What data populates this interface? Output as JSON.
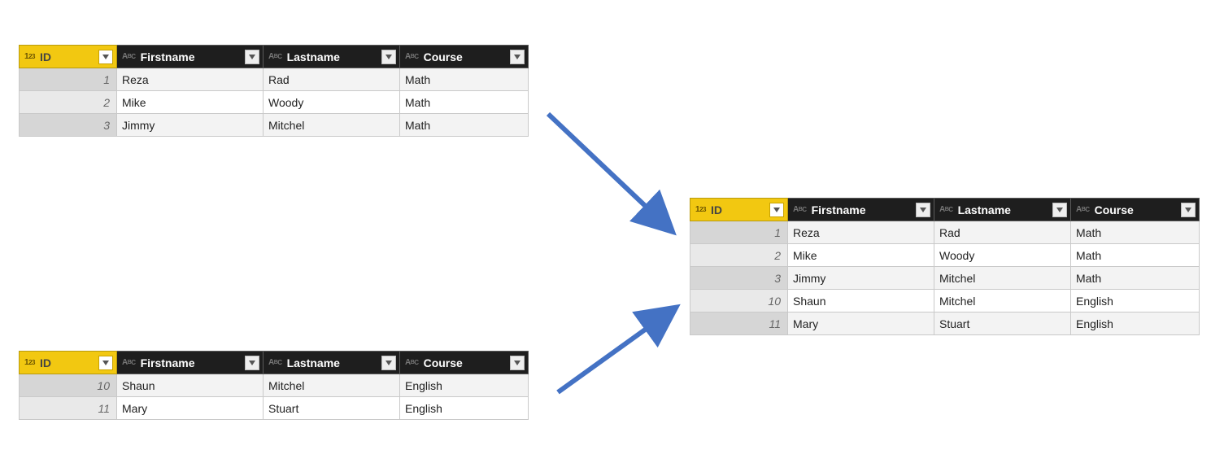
{
  "columns": {
    "id": {
      "label": "ID",
      "type": "int",
      "type_display": "1²₃"
    },
    "first": {
      "label": "Firstname",
      "type": "text",
      "type_display": "AᴮC"
    },
    "last": {
      "label": "Lastname",
      "type": "text",
      "type_display": "AᴮC"
    },
    "course": {
      "label": "Course",
      "type": "text",
      "type_display": "AᴮC"
    }
  },
  "colors": {
    "highlight": "#f2c811",
    "header_bg": "#1e1e1e",
    "arrow": "#4472c4"
  },
  "tables": {
    "top": {
      "rows": [
        {
          "id": 1,
          "first": "Reza",
          "last": "Rad",
          "course": "Math"
        },
        {
          "id": 2,
          "first": "Mike",
          "last": "Woody",
          "course": "Math"
        },
        {
          "id": 3,
          "first": "Jimmy",
          "last": "Mitchel",
          "course": "Math"
        }
      ]
    },
    "bottom": {
      "rows": [
        {
          "id": 10,
          "first": "Shaun",
          "last": "Mitchel",
          "course": "English"
        },
        {
          "id": 11,
          "first": "Mary",
          "last": "Stuart",
          "course": "English"
        }
      ]
    },
    "result": {
      "rows": [
        {
          "id": 1,
          "first": "Reza",
          "last": "Rad",
          "course": "Math"
        },
        {
          "id": 2,
          "first": "Mike",
          "last": "Woody",
          "course": "Math"
        },
        {
          "id": 3,
          "first": "Jimmy",
          "last": "Mitchel",
          "course": "Math"
        },
        {
          "id": 10,
          "first": "Shaun",
          "last": "Mitchel",
          "course": "English"
        },
        {
          "id": 11,
          "first": "Mary",
          "last": "Stuart",
          "course": "English"
        }
      ]
    }
  }
}
